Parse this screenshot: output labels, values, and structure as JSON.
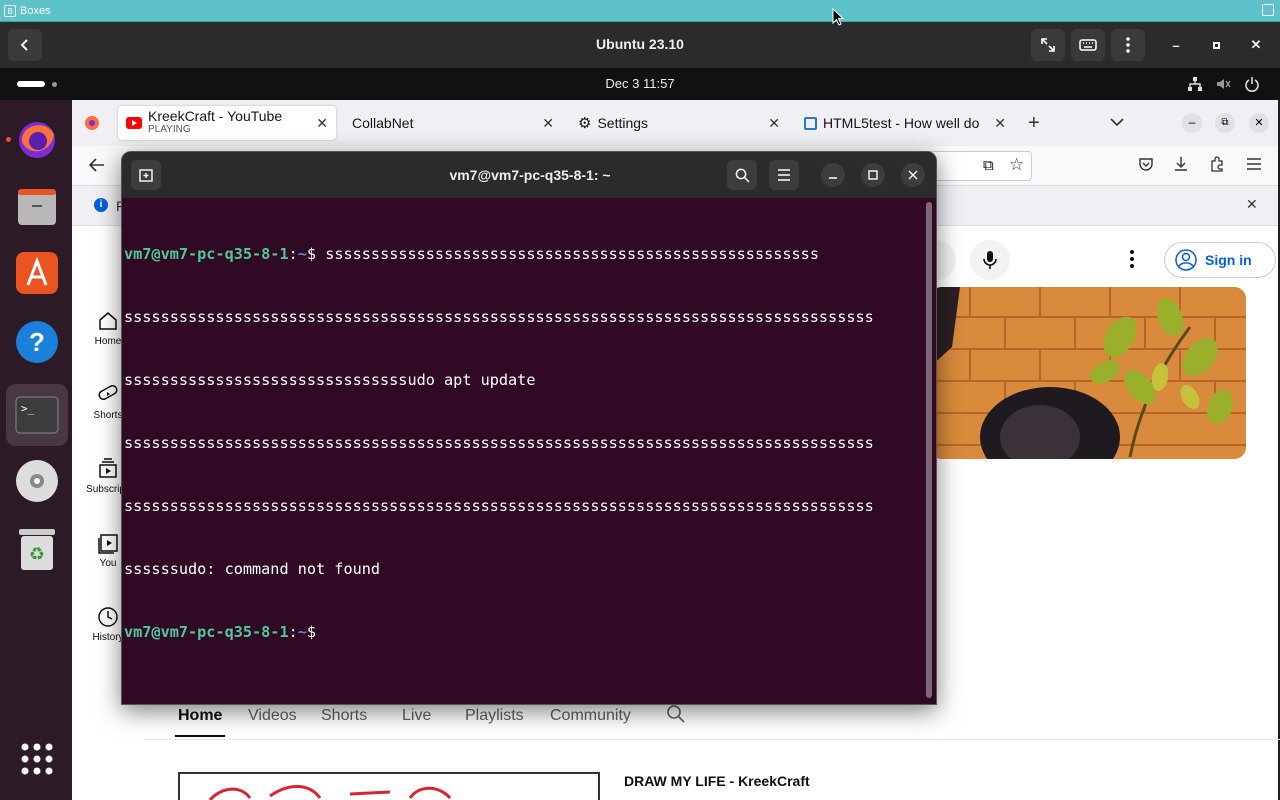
{
  "host": {
    "app_name": "Boxes",
    "vm_title": "Ubuntu 23.10"
  },
  "guest_topbar": {
    "clock": "Dec 3  11:57"
  },
  "firefox": {
    "tabs": [
      {
        "label": "KreekCraft - YouTube",
        "sub": "PLAYING"
      },
      {
        "label": "CollabNet"
      },
      {
        "label": "Settings"
      },
      {
        "label": "HTML5test - How well do"
      }
    ],
    "infobar_text": "F"
  },
  "youtube": {
    "sidebar": [
      {
        "label": "Home",
        "icon": "home-icon"
      },
      {
        "label": "Shorts",
        "icon": "shorts-icon"
      },
      {
        "label": "Subscripti",
        "icon": "subscriptions-icon"
      },
      {
        "label": "You",
        "icon": "you-icon"
      },
      {
        "label": "History",
        "icon": "history-icon"
      }
    ],
    "sign_in": "Sign in",
    "channel_tabs": [
      "Home",
      "Videos",
      "Shorts",
      "Live",
      "Playlists",
      "Community"
    ],
    "video_title": "DRAW MY LIFE - KreekCraft"
  },
  "terminal": {
    "title": "vm7@vm7-pc-q35-8-1: ~",
    "lines": [
      {
        "user": "vm7@vm7-pc-q35-8-1",
        "path": "~",
        "sym": "$ ",
        "text": "ssssssssssssssssssssssssssssssssssssssssssssssssssssss"
      },
      {
        "text": "ssssssssssssssssssssssssssssssssssssssssssssssssssssssssssssssssssssssssssssssssss"
      },
      {
        "text": "sssssssssssssssssssssssssssssssudo apt update"
      },
      {
        "text": "ssssssssssssssssssssssssssssssssssssssssssssssssssssssssssssssssssssssssssssssssss"
      },
      {
        "text": "ssssssssssssssssssssssssssssssssssssssssssssssssssssssssssssssssssssssssssssssssss"
      },
      {
        "text": "ssssssudo: command not found"
      },
      {
        "user": "vm7@vm7-pc-q35-8-1",
        "path": "~",
        "sym": "$ ",
        "text": ""
      }
    ]
  }
}
